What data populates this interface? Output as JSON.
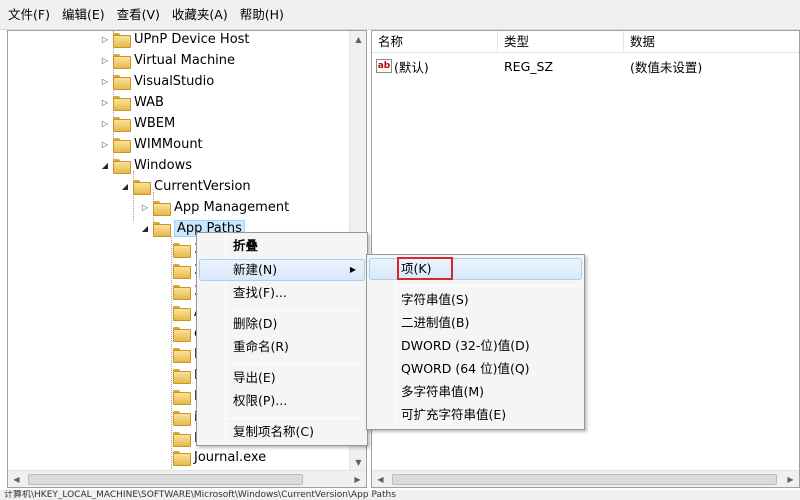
{
  "menubar": [
    "文件(F)",
    "编辑(E)",
    "查看(V)",
    "收藏夹(A)",
    "帮助(H)"
  ],
  "tree": {
    "items": [
      {
        "label": "UPnP Device Host",
        "expander": "▷"
      },
      {
        "label": "Virtual Machine",
        "expander": "▷"
      },
      {
        "label": "VisualStudio",
        "expander": "▷"
      },
      {
        "label": "WAB",
        "expander": "▷"
      },
      {
        "label": "WBEM",
        "expander": "▷"
      },
      {
        "label": "WIMMount",
        "expander": "▷"
      },
      {
        "label": "Windows",
        "expander": "◢"
      },
      {
        "label": "CurrentVersion",
        "expander": "◢"
      },
      {
        "label": "App Management",
        "expander": "▷"
      },
      {
        "label": "App Paths",
        "expander": "◢"
      },
      {
        "label": "3",
        "expander": ""
      },
      {
        "label": "3",
        "expander": ""
      },
      {
        "label": "3",
        "expander": ""
      },
      {
        "label": "A",
        "expander": ""
      },
      {
        "label": "c",
        "expander": ""
      },
      {
        "label": "E",
        "expander": ""
      },
      {
        "label": "E",
        "expander": ""
      },
      {
        "label": "E",
        "expander": ""
      },
      {
        "label": "i",
        "expander": ""
      },
      {
        "label": "I",
        "expander": ""
      },
      {
        "label": "Journal.exe",
        "expander": ""
      }
    ]
  },
  "list": {
    "headers": [
      "名称",
      "类型",
      "数据"
    ],
    "rows": [
      {
        "icon": "ab",
        "name": "(默认)",
        "type": "REG_SZ",
        "data": "(数值未设置)"
      }
    ]
  },
  "context_menu": {
    "items": [
      "折叠",
      "新建(N)",
      "查找(F)...",
      "删除(D)",
      "重命名(R)",
      "导出(E)",
      "权限(P)...",
      "复制项名称(C)"
    ]
  },
  "submenu": {
    "items": [
      "项(K)",
      "字符串值(S)",
      "二进制值(B)",
      "DWORD (32-位)值(D)",
      "QWORD (64 位)值(Q)",
      "多字符串值(M)",
      "可扩充字符串值(E)"
    ]
  },
  "statusbar": "计算机\\HKEY_LOCAL_MACHINE\\SOFTWARE\\Microsoft\\Windows\\CurrentVersion\\App Paths",
  "colors": {
    "highlight_box": "#d9252c",
    "selection": "#cce8ff"
  },
  "icons": {
    "scroll_up": "▲",
    "scroll_down": "▼",
    "scroll_left": "◀",
    "scroll_right": "▶",
    "submenu_arrow": "▶"
  }
}
